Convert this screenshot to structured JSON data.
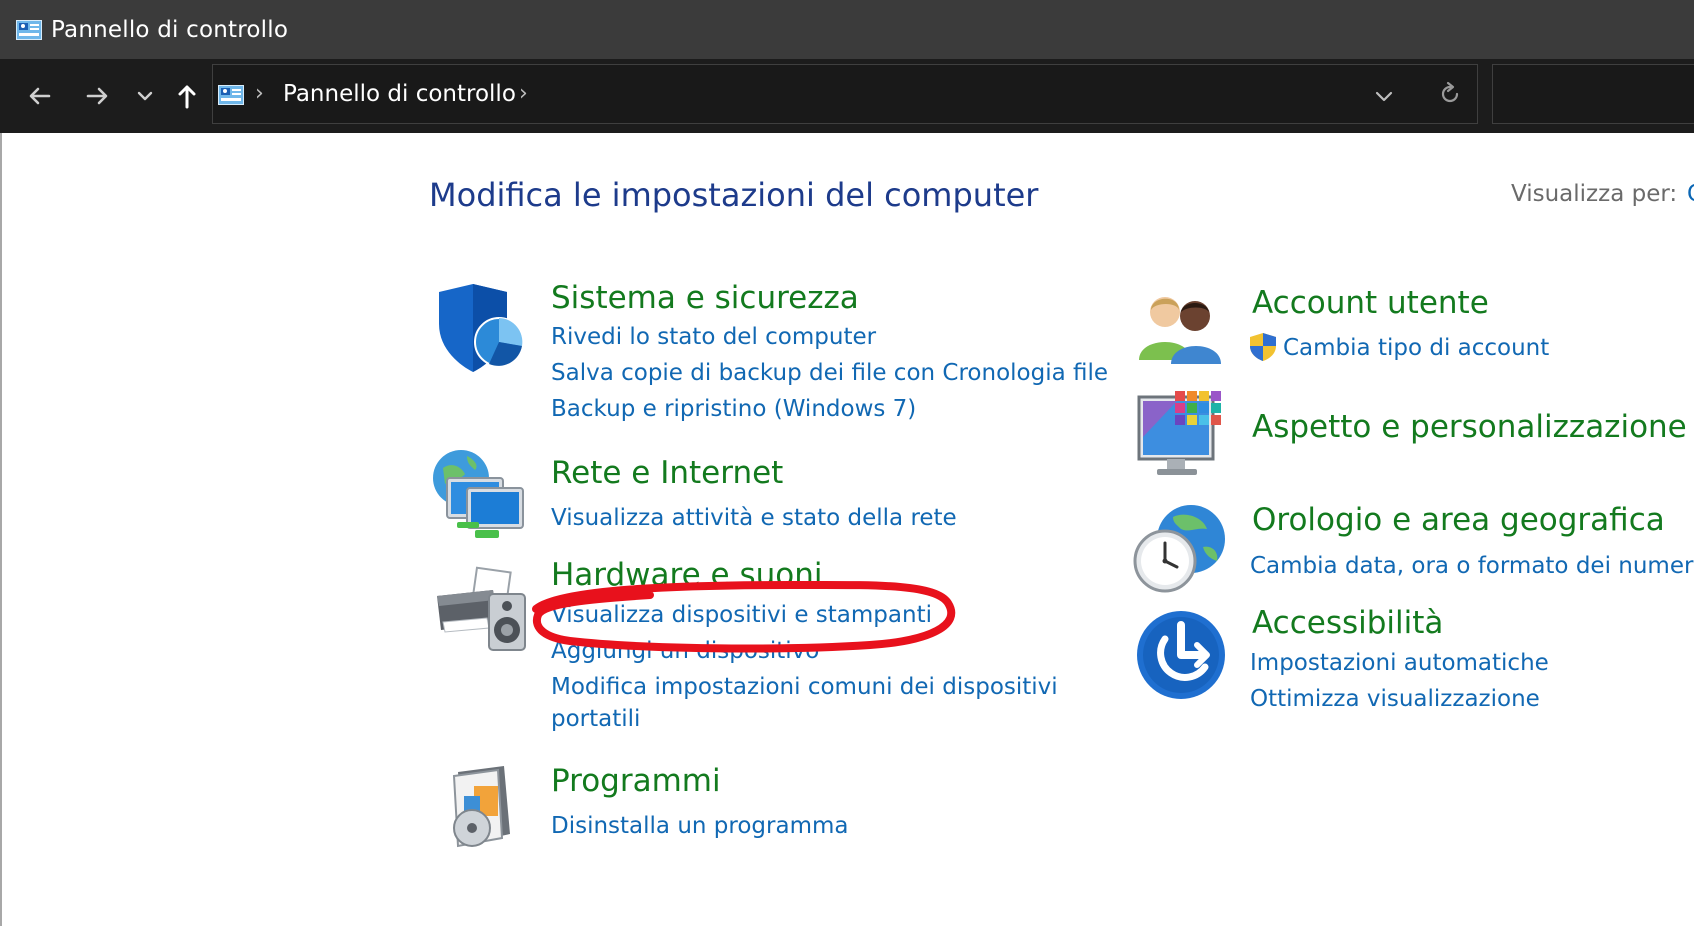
{
  "window": {
    "title": "Pannello di controllo"
  },
  "address": {
    "location": "Pannello di controllo"
  },
  "main": {
    "heading": "Modifica le impostazioni del computer",
    "view_by_label": "Visualizza per:",
    "view_by_value": "C"
  },
  "categories": {
    "system": {
      "title": "Sistema e sicurezza",
      "links": [
        "Rivedi lo stato del computer",
        "Salva copie di backup dei file con Cronologia file",
        "Backup e ripristino (Windows 7)"
      ]
    },
    "network": {
      "title": "Rete e Internet",
      "links": [
        "Visualizza attività e stato della rete"
      ]
    },
    "hardware": {
      "title": "Hardware e suoni",
      "links": [
        "Visualizza dispositivi e stampanti",
        "Aggiungi un dispositivo",
        "Modifica impostazioni comuni dei dispositivi",
        "portatili"
      ]
    },
    "programs": {
      "title": "Programmi",
      "links": [
        "Disinstalla un programma"
      ]
    },
    "accounts": {
      "title": "Account utente",
      "links": [
        "Cambia tipo di account"
      ]
    },
    "appearance": {
      "title": "Aspetto e personalizzazione",
      "links": []
    },
    "clock": {
      "title": "Orologio e area geografica",
      "links": [
        "Cambia data, ora o formato dei numeri"
      ]
    },
    "accessibility": {
      "title": "Accessibilità",
      "links": [
        "Impostazioni automatiche",
        "Ottimizza visualizzazione"
      ]
    }
  },
  "icons": {
    "app": "control-panel-icon",
    "back": "arrow-left-icon",
    "forward": "arrow-right-icon",
    "recent": "chevron-down-icon",
    "up": "arrow-up-icon",
    "refresh": "refresh-icon"
  },
  "colors": {
    "category_title": "#137a1e",
    "link": "#1168b3",
    "heading": "#1d3b8b",
    "annotation": "#e8111c"
  }
}
